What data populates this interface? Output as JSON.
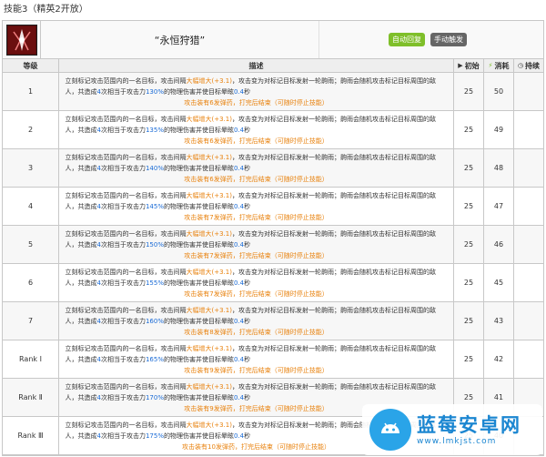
{
  "section_title": "技能3（精英2开放）",
  "skill": {
    "name": "“永恒狩猎”",
    "tags": [
      {
        "label": "自动回复",
        "color": "#7fbf2a"
      },
      {
        "label": "手动触发",
        "color": "#666666"
      }
    ],
    "icon": "skill-emblem-icon"
  },
  "columns": {
    "level": "等级",
    "desc": "描述",
    "init": "初始",
    "cost": "消耗",
    "duration": "持续",
    "init_icon": "play-icon",
    "cost_icon": "lightning-icon",
    "duration_icon": "clock-icon"
  },
  "rows": [
    {
      "level": "1",
      "pct": "130%",
      "bullets": "6发弹药",
      "init": "25",
      "cost": "50",
      "duration": ""
    },
    {
      "level": "2",
      "pct": "135%",
      "bullets": "6发弹药",
      "init": "25",
      "cost": "49",
      "duration": ""
    },
    {
      "level": "3",
      "pct": "140%",
      "bullets": "6发弹药",
      "init": "25",
      "cost": "48",
      "duration": ""
    },
    {
      "level": "4",
      "pct": "145%",
      "bullets": "7发弹药",
      "init": "25",
      "cost": "47",
      "duration": ""
    },
    {
      "level": "5",
      "pct": "150%",
      "bullets": "7发弹药",
      "init": "25",
      "cost": "46",
      "duration": ""
    },
    {
      "level": "6",
      "pct": "155%",
      "bullets": "7发弹药",
      "init": "25",
      "cost": "45",
      "duration": ""
    },
    {
      "level": "7",
      "pct": "160%",
      "bullets": "8发弹药",
      "init": "25",
      "cost": "43",
      "duration": ""
    },
    {
      "level": "Rank Ⅰ",
      "pct": "165%",
      "bullets": "9发弹药",
      "init": "25",
      "cost": "42",
      "duration": ""
    },
    {
      "level": "Rank Ⅱ",
      "pct": "170%",
      "bullets": "9发弹药",
      "init": "25",
      "cost": "41",
      "duration": ""
    },
    {
      "level": "Rank Ⅲ",
      "pct": "175%",
      "bullets": "10发弹药",
      "init": "25",
      "cost": "40",
      "duration": ""
    }
  ],
  "desc_parts": {
    "a": "立刻标记攻击范围内的一名目标，攻击间隔",
    "b": "大幅增大(+3.1)",
    "c": "，攻击变为对标记目标发射一轮齁雨；齁雨会随机攻击标记目标周围的敌人，共造成",
    "d": "4",
    "e": "次相当于攻击力",
    "f": "的物理伤害并使目标晕眩",
    "g": "0.4",
    "h": "秒",
    "note_prefix": "攻击装有",
    "note_suffix": "，打完后结束（可随时停止技能）"
  },
  "watermark": {
    "title": "蓝莓安卓网",
    "url": "www.lmkjst.com",
    "icon": "android-robot-icon"
  }
}
